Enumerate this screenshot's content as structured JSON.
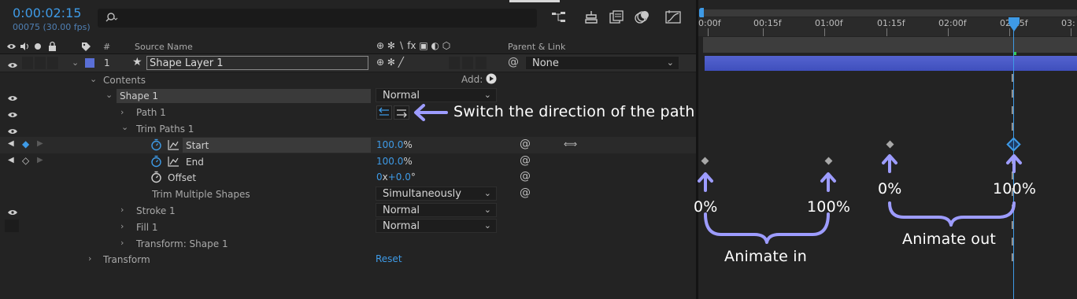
{
  "header": {
    "timecode": "0:00:02:15",
    "frame_info": "00075 (30.00 fps)",
    "search_placeholder": ""
  },
  "columns": {
    "number": "#",
    "source_name": "Source Name",
    "switch_icons": "⊕ ✻ ∖ fx ▣ ◐ ⬡",
    "parent_link": "Parent & Link"
  },
  "layer": {
    "number": "1",
    "name": "Shape Layer 1",
    "parent": "None"
  },
  "properties": {
    "contents": "Contents",
    "add_label": "Add:",
    "shape1": "Shape 1",
    "shape1_mode": "Normal",
    "path1": "Path 1",
    "trim_paths": "Trim Paths 1",
    "start_label": "Start",
    "start_value": "100.0",
    "start_unit": "%",
    "end_label": "End",
    "end_value": "100.0",
    "end_unit": "%",
    "offset_label": "Offset",
    "offset_rev": "0",
    "offset_x": "x",
    "offset_deg": "+0.0",
    "offset_unit": "°",
    "trim_multiple": "Trim Multiple Shapes",
    "trim_multiple_value": "Simultaneously",
    "stroke": "Stroke 1",
    "stroke_mode": "Normal",
    "fill": "Fill 1",
    "fill_mode": "Normal",
    "transform_shape": "Transform: Shape 1",
    "transform": "Transform",
    "reset": "Reset"
  },
  "ruler": {
    "ticks": [
      "0:00f",
      "00:15f",
      "01:00f",
      "01:15f",
      "02:00f",
      "02:15f",
      "03:"
    ]
  },
  "annotations": {
    "path_direction": "Switch the direction of the path",
    "in_start": "0%",
    "in_end": "100%",
    "out_start": "0%",
    "out_end": "100%",
    "animate_in": "Animate in",
    "animate_out": "Animate out"
  },
  "colors": {
    "accent_blue": "#3e9ae6",
    "layer_label": "#5a6fd6",
    "annotation_purple": "#9d9cff",
    "layer_bar": "#4a5bc9"
  },
  "icons": {
    "search": "search-icon",
    "flowchart": "flowchart-icon",
    "solo": "solo-icon",
    "comp": "comp-icon",
    "motion_blur": "motion-blur-icon",
    "graph": "graph-editor-icon",
    "stopwatch": "stopwatch-icon",
    "spiral": "pickwhip-icon",
    "eye": "eye-icon",
    "keyframe": "keyframe-icon",
    "star": "star-icon",
    "play": "add-play-icon"
  }
}
